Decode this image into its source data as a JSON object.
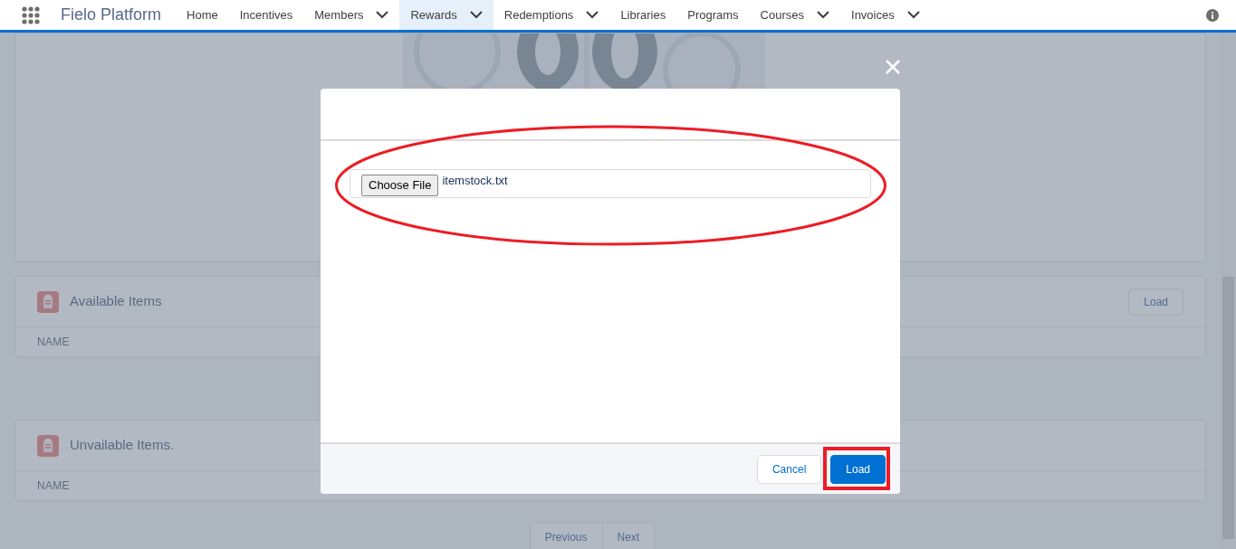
{
  "app": {
    "name": "Fielo Platform"
  },
  "nav": [
    {
      "label": "Home",
      "dropdown": false,
      "selected": false
    },
    {
      "label": "Incentives",
      "dropdown": false,
      "selected": false
    },
    {
      "label": "Members",
      "dropdown": true,
      "selected": false
    },
    {
      "label": "Rewards",
      "dropdown": true,
      "selected": true
    },
    {
      "label": "Redemptions",
      "dropdown": true,
      "selected": false
    },
    {
      "label": "Libraries",
      "dropdown": false,
      "selected": false
    },
    {
      "label": "Programs",
      "dropdown": false,
      "selected": false
    },
    {
      "label": "Courses",
      "dropdown": true,
      "selected": false
    },
    {
      "label": "Invoices",
      "dropdown": true,
      "selected": false
    }
  ],
  "sections": [
    {
      "title": "Available Items",
      "column": "NAME",
      "button": "Load"
    },
    {
      "title": "Unvailable Items.",
      "column": "NAME"
    }
  ],
  "pagination": [
    "Previous",
    "Next"
  ],
  "modal": {
    "file_field": {
      "button": "Choose File",
      "value": "itemstock.txt"
    },
    "buttons": [
      {
        "label": "Cancel",
        "kind": "neutral"
      },
      {
        "label": "Load",
        "kind": "brand"
      }
    ]
  }
}
